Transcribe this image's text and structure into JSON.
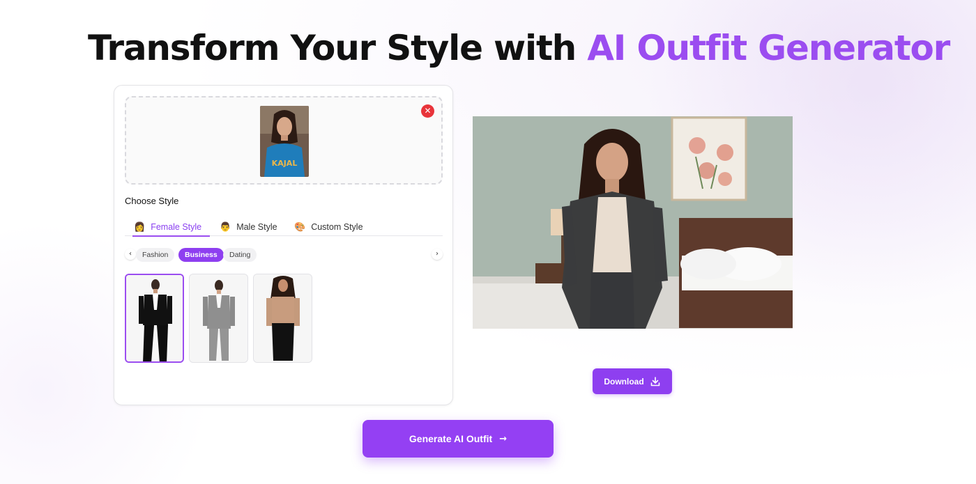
{
  "headline": {
    "prefix": "Transform Your Style with ",
    "accent": "AI Outfit Generator"
  },
  "colors": {
    "accent": "#9b4df0",
    "button": "#8e3ff0",
    "remove": "#e8343a"
  },
  "upload": {
    "shirt_text": "KAJAL",
    "remove_icon": "✕"
  },
  "style_panel": {
    "label": "Choose Style",
    "tabs": [
      {
        "emoji": "👩",
        "label": "Female Style",
        "active": true
      },
      {
        "emoji": "👨",
        "label": "Male Style",
        "active": false
      },
      {
        "emoji": "🎨",
        "label": "Custom Style",
        "active": false
      }
    ],
    "categories": [
      {
        "label": "Fashion",
        "active": false
      },
      {
        "label": "Business",
        "active": true
      },
      {
        "label": "Dating",
        "active": false
      }
    ],
    "prev_icon": "‹",
    "next_icon": "›",
    "outfits": [
      {
        "icon": "black-suit-figure",
        "selected": true
      },
      {
        "icon": "grey-suit-figure",
        "selected": false
      },
      {
        "icon": "satin-blouse-figure",
        "selected": false
      }
    ]
  },
  "result": {
    "icon": "generated-photo"
  },
  "actions": {
    "download_label": "Download",
    "download_icon": "download-icon",
    "generate_label": "Generate AI Outfit",
    "generate_arrow": "→"
  }
}
